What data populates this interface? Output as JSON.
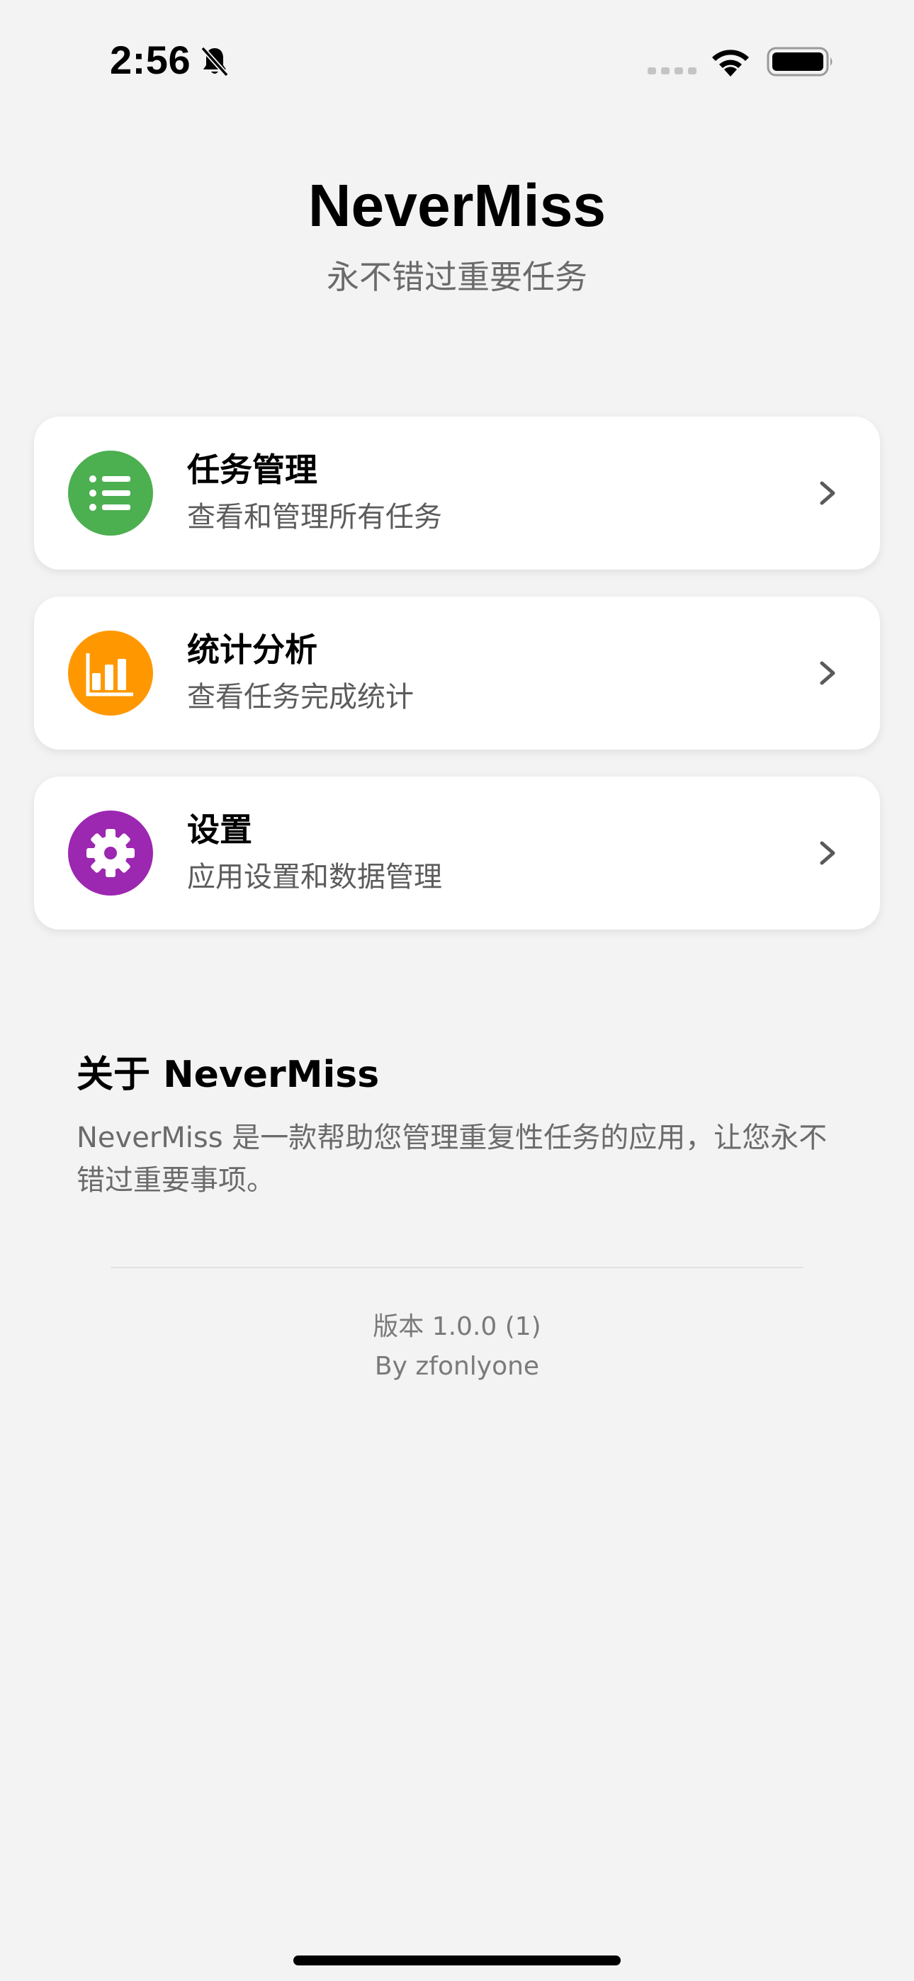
{
  "status_bar": {
    "time": "2:56",
    "icons": [
      "bell-slash-icon",
      "cellular-signal-icon",
      "wifi-icon",
      "battery-icon"
    ]
  },
  "header": {
    "title": "NeverMiss",
    "subtitle": "永不错过重要任务"
  },
  "menu": {
    "items": [
      {
        "title": "任务管理",
        "description": "查看和管理所有任务",
        "icon": "list-icon",
        "color": "#4caf50"
      },
      {
        "title": "统计分析",
        "description": "查看任务完成统计",
        "icon": "bar-chart-icon",
        "color": "#ff9800"
      },
      {
        "title": "设置",
        "description": "应用设置和数据管理",
        "icon": "gear-icon",
        "color": "#9c27b0"
      }
    ]
  },
  "about": {
    "title": "关于 NeverMiss",
    "body": "NeverMiss 是一款帮助您管理重复性任务的应用，让您永不错过重要事项。"
  },
  "footer": {
    "version": "版本 1.0.0 (1)",
    "author": "By zfonlyone"
  }
}
